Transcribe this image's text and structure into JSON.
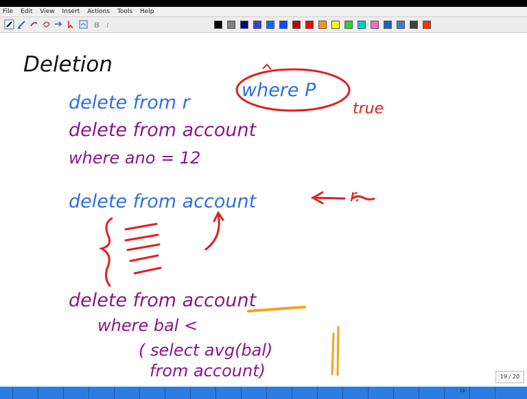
{
  "menu": [
    "File",
    "Edit",
    "View",
    "Insert",
    "Actions",
    "Tools",
    "Help"
  ],
  "toolbar": {
    "colors": [
      "#000000",
      "#808080",
      "#000080",
      "#4040c0",
      "#0070ff",
      "#0050ff",
      "#c00000",
      "#ff0000",
      "#ff9900",
      "#ffff00",
      "#33cc33",
      "#00cccc",
      "#ff66cc",
      "#2060c0",
      "#3a7bd5",
      "#404040",
      "#ff3300"
    ]
  },
  "notes": {
    "title": "Deletion",
    "line1": "delete from r",
    "where_p": "where P",
    "true_label": "true",
    "line2a": "delete from account",
    "line2b": "where ano = 12",
    "line3": "delete from account",
    "r_note": "r.",
    "line4a": "delete from account",
    "line4b": "where bal <",
    "line4c": "( select avg(bal)",
    "line4d": "from account)"
  },
  "page_indicator": "19 / 20",
  "slide_num": "19"
}
